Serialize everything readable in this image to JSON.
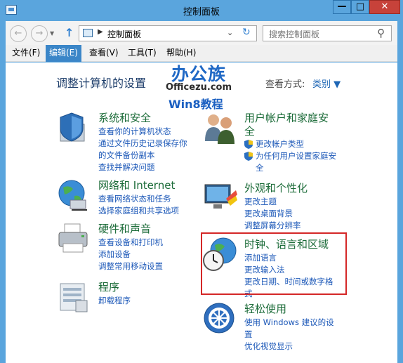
{
  "window": {
    "title": "控制面板"
  },
  "address": {
    "path": "控制面板",
    "search_placeholder": "搜索控制面板"
  },
  "menu": [
    "文件(F)",
    "编辑(E)",
    "查看(V)",
    "工具(T)",
    "帮助(H)"
  ],
  "heading": "调整计算机的设置",
  "view_by": {
    "label": "查看方式:",
    "value": "类别 ▼"
  },
  "watermark": {
    "big": "办公族",
    "domain": "Officezu.com",
    "tag": "Win8教程"
  },
  "categories": {
    "system": {
      "title": "系统和安全",
      "icon": "shield-icon",
      "links": [
        "查看你的计算机状态",
        "通过文件历史记录保存你",
        "的文件备份副本",
        "查找并解决问题"
      ]
    },
    "network": {
      "title": "网络和 Internet",
      "icon": "globe-network-icon",
      "links": [
        "查看网络状态和任务",
        "选择家庭组和共享选项"
      ]
    },
    "hardware": {
      "title": "硬件和声音",
      "icon": "printer-icon",
      "links": [
        "查看设备和打印机",
        "添加设备",
        "调整常用移动设置"
      ]
    },
    "programs": {
      "title": "程序",
      "icon": "programs-icon",
      "links": [
        "卸载程序"
      ]
    },
    "users": {
      "title_l1": "用户帐户和家庭安",
      "title_l2": "全",
      "icon": "users-icon",
      "links": [
        "更改帐户类型",
        "为任何用户设置家庭安",
        "全"
      ]
    },
    "appearance": {
      "title": "外观和个性化",
      "icon": "monitor-icon",
      "links": [
        "更改主题",
        "更改桌面背景",
        "调整屏幕分辨率"
      ]
    },
    "clock": {
      "title": "时钟、语言和区域",
      "icon": "clock-globe-icon",
      "links": [
        "添加语言",
        "更改输入法",
        "更改日期、时间或数字格",
        "式"
      ]
    },
    "ease": {
      "title": "轻松使用",
      "icon": "ease-of-access-icon",
      "links": [
        "使用 Windows 建议的设",
        "置",
        "优化视觉显示"
      ]
    }
  }
}
